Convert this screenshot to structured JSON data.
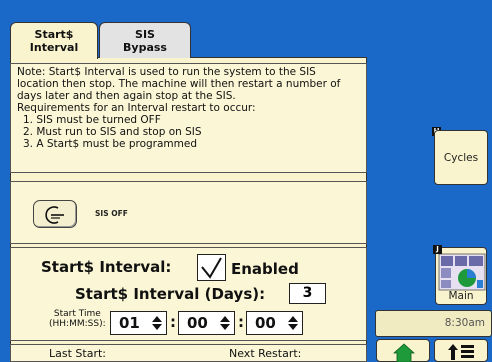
{
  "tabs": [
    {
      "label_line1": "Start$",
      "label_line2": "Interval"
    },
    {
      "label_line1": "SIS",
      "label_line2": "Bypass"
    }
  ],
  "note": {
    "text": "Note: Start$ Interval is used to run the system to the SIS location then stop. The machine will then restart a number of days later and then again stop at the SIS.",
    "requirements_title": "Requirements for an Interval restart to occur:",
    "requirements": [
      "1. SIS must be turned OFF",
      "2. Must run to SIS and stop on SIS",
      "3. A Start$ must be programmed"
    ]
  },
  "sis": {
    "status_label": "SIS OFF",
    "icon": "sis-toggle-icon"
  },
  "interval": {
    "enabled_label": "Start$ Interval:",
    "enabled_checked": true,
    "enabled_text": "Enabled",
    "days_label": "Start$ Interval (Days):",
    "days_value": "3",
    "start_time_label_line1": "Start Time",
    "start_time_label_line2": "(HH:MM:SS):",
    "hours": "01",
    "minutes": "00",
    "seconds": "00",
    "colon": ":"
  },
  "bottom": {
    "last_start_label": "Last Start:",
    "next_restart_label": "Next Restart:"
  },
  "side": {
    "cycles_label": "Cycles",
    "cycles_badge": "H",
    "main_label": "Main",
    "main_badge": "J",
    "time": "8:30am"
  },
  "colors": {
    "background": "#1a68c8",
    "panel": "#f9f4cd",
    "accent_green": "#1e9a3a"
  }
}
